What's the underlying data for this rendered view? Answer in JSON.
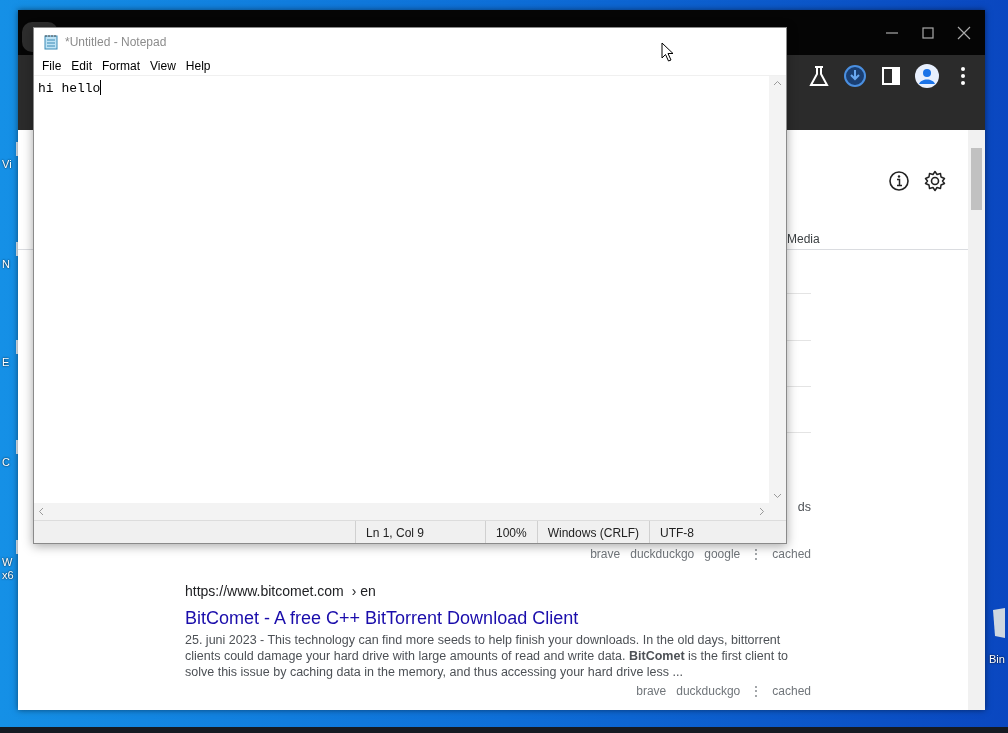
{
  "desktop": {
    "icons": [
      {
        "lines": [
          "Vi"
        ]
      },
      {
        "lines": [
          "N"
        ]
      },
      {
        "lines": [
          "E"
        ]
      },
      {
        "lines": [
          "C"
        ]
      },
      {
        "lines": [
          "W",
          "x6"
        ]
      }
    ],
    "recycle_bin": {
      "label": "Bin"
    }
  },
  "browser": {
    "page": {
      "tabs": [
        {
          "label": "Media",
          "selected": false
        }
      ],
      "hidden_snippet_end": "ds",
      "first_footer": {
        "links": [
          "brave",
          "duckduckgo",
          "google"
        ],
        "more": "⋮",
        "cached": "cached"
      },
      "result": {
        "url": "https://www.bitcomet.com",
        "breadcrumb": "› en",
        "title": "BitComet - A free C++ BitTorrent Download Client",
        "snippet": "25. juni 2023 - This technology can find more seeds to help finish your downloads. In the old days, bittorrent clients could damage your hard drive with large amounts of read and write data. **BitComet** is the first client to solve this issue by caching data in the memory, and thus accessing your hard drive less ...",
        "links": [
          "brave",
          "duckduckgo"
        ],
        "more": "⋮",
        "cached": "cached"
      }
    }
  },
  "notepad": {
    "title": "*Untitled - Notepad",
    "menu": [
      "File",
      "Edit",
      "Format",
      "View",
      "Help"
    ],
    "text": "hi hello",
    "status": {
      "position": "Ln 1, Col 9",
      "zoom": "100%",
      "line_ending": "Windows (CRLF)",
      "encoding": "UTF-8"
    }
  }
}
